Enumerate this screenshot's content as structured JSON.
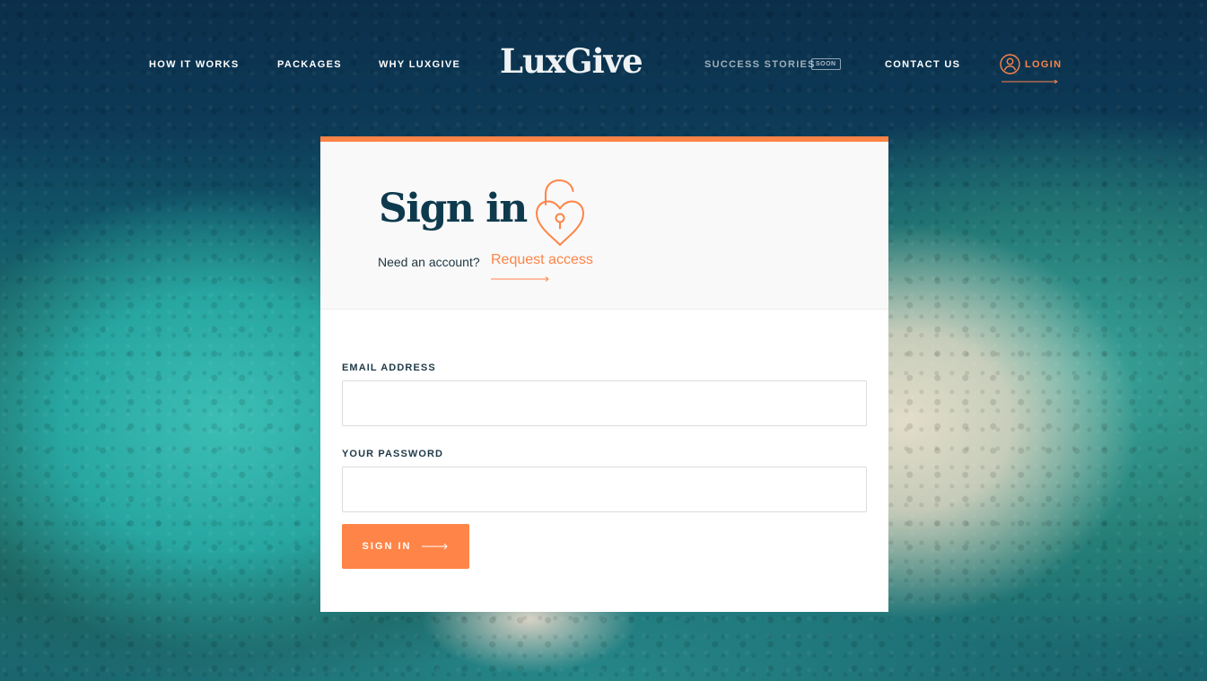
{
  "nav": {
    "how_it_works": "HOW IT WORKS",
    "packages": "PACKAGES",
    "why_luxgive": "WHY LUXGIVE",
    "logo": "LuxGive",
    "success_stories": "SUCCESS STORIES",
    "soon_badge": "SOON",
    "contact_us": "CONTACT US",
    "login": "LOGIN"
  },
  "signin": {
    "title": "Sign in",
    "need_account": "Need an account?",
    "request_access": "Request access",
    "email_label": "EMAIL ADDRESS",
    "email_value": "",
    "password_label": "YOUR PASSWORD",
    "password_value": "",
    "submit_label": "SIGN IN"
  },
  "icons": {
    "login": "user-circle-icon",
    "lock": "heart-lock-icon",
    "arrow": "long-arrow-right-icon"
  },
  "colors": {
    "accent": "#ff8447",
    "heading": "#0f3a4d",
    "text": "#1e3542"
  }
}
